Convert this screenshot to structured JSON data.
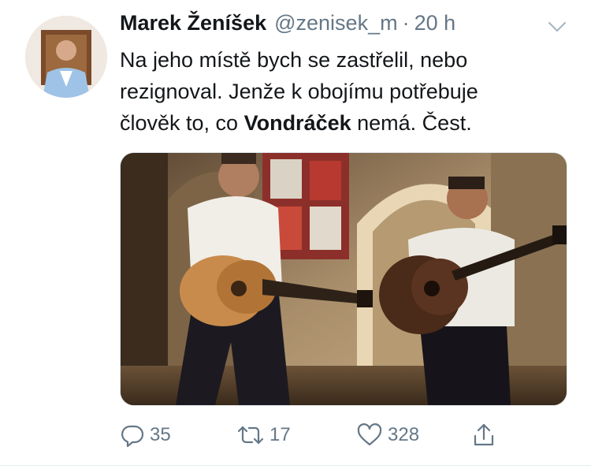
{
  "tweet": {
    "author_name": "Marek Ženíšek",
    "handle": "@zenisek_m",
    "separator": "·",
    "time": "20 h",
    "text_line1": "Na jeho místě bych se zastřelil, nebo",
    "text_line2": "rezignoval. Jenže k obojímu potřebuje",
    "text_line3_pre": "člověk to, co ",
    "text_line3_bold": "Vondráček",
    "text_line3_post": " nemá. Čest."
  },
  "actions": {
    "reply_count": "35",
    "retweet_count": "17",
    "like_count": "328"
  },
  "icons": {
    "menu": "chevron-down-icon",
    "reply": "reply-icon",
    "retweet": "retweet-icon",
    "like": "heart-icon",
    "share": "share-icon"
  },
  "colors": {
    "text": "#14171a",
    "secondary": "#657786",
    "divider": "#e6ecf0"
  }
}
